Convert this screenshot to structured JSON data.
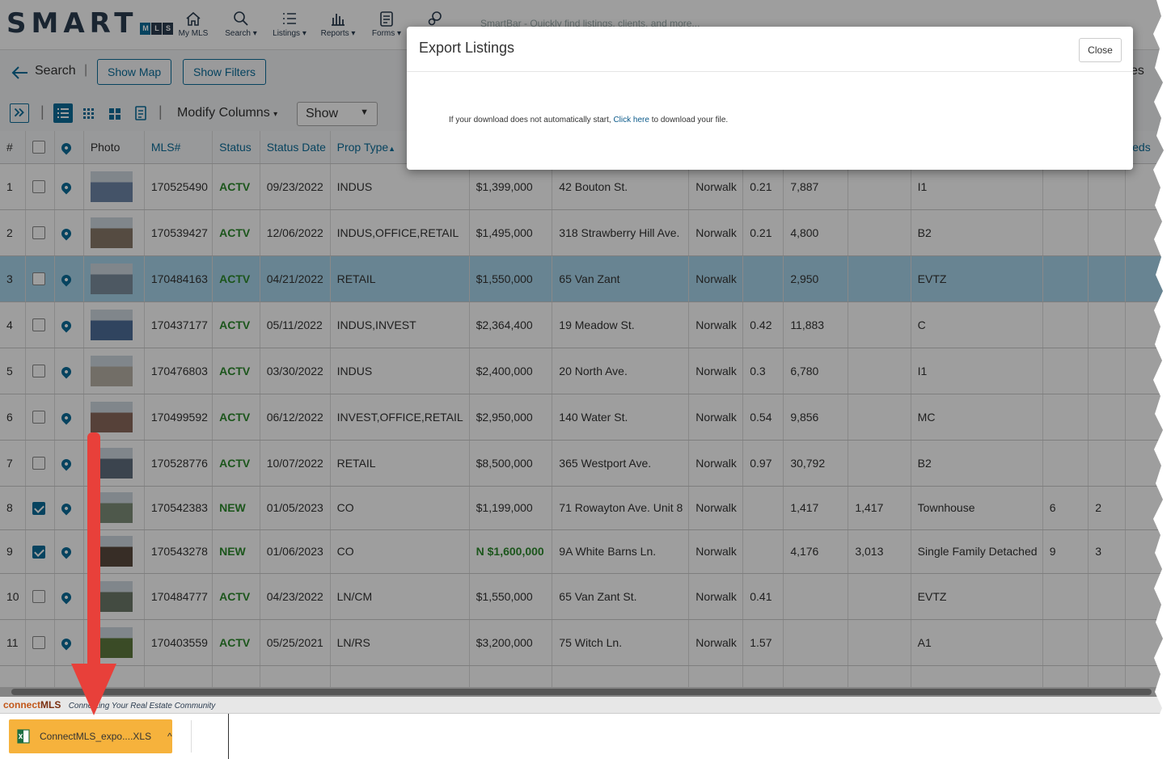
{
  "header": {
    "logo_text": "SMART",
    "logo_mls": [
      "M",
      "L",
      "S"
    ],
    "nav": [
      {
        "label": "My MLS",
        "icon": "home-icon"
      },
      {
        "label": "Search ▾",
        "icon": "search-icon"
      },
      {
        "label": "Listings ▾",
        "icon": "list-icon"
      },
      {
        "label": "Reports ▾",
        "icon": "bar-chart-icon"
      },
      {
        "label": "Forms ▾",
        "icon": "document-icon"
      },
      {
        "label": "",
        "icon": "gears-icon"
      }
    ],
    "smartbar_placeholder": "SmartBar - Quickly find listings, clients, and more..."
  },
  "toolbar": {
    "back_label": "Search",
    "show_map": "Show Map",
    "show_filters": "Show Filters",
    "right_partial": "es",
    "modify_columns": "Modify Columns",
    "show_select": "Show"
  },
  "grid": {
    "columns": [
      "#",
      "",
      "",
      "Photo",
      "MLS#",
      "Status",
      "Status Date",
      "Prop Type",
      "",
      "",
      "",
      "",
      "",
      "",
      "",
      "",
      "",
      "eds"
    ],
    "rows": [
      {
        "num": "1",
        "checked": false,
        "mls": "170525490",
        "status": "ACTV",
        "date": "09/23/2022",
        "type": "INDUS",
        "price": "$1,399,000",
        "address": "42 Bouton St.",
        "town": "Norwalk",
        "acres": "0.21",
        "sqft": "7,887",
        "sqft2": "",
        "zone": "I1",
        "c1": "",
        "c2": "",
        "selected": false,
        "price_hi": false,
        "photo": "#6f86a8"
      },
      {
        "num": "2",
        "checked": false,
        "mls": "170539427",
        "status": "ACTV",
        "date": "12/06/2022",
        "type": "INDUS,OFFICE,RETAIL",
        "price": "$1,495,000",
        "address": "318 Strawberry Hill Ave.",
        "town": "Norwalk",
        "acres": "0.21",
        "sqft": "4,800",
        "sqft2": "",
        "zone": "B2",
        "c1": "",
        "c2": "",
        "selected": false,
        "price_hi": false,
        "photo": "#8a7a6a"
      },
      {
        "num": "3",
        "checked": false,
        "mls": "170484163",
        "status": "ACTV",
        "date": "04/21/2022",
        "type": "RETAIL",
        "price": "$1,550,000",
        "address": "65 Van Zant",
        "town": "Norwalk",
        "acres": "",
        "sqft": "2,950",
        "sqft2": "",
        "zone": "EVTZ",
        "c1": "",
        "c2": "",
        "selected": true,
        "price_hi": false,
        "photo": "#7d8f9f"
      },
      {
        "num": "4",
        "checked": false,
        "mls": "170437177",
        "status": "ACTV",
        "date": "05/11/2022",
        "type": "INDUS,INVEST",
        "price": "$2,364,400",
        "address": "19 Meadow St.",
        "town": "Norwalk",
        "acres": "0.42",
        "sqft": "11,883",
        "sqft2": "",
        "zone": "C",
        "c1": "",
        "c2": "",
        "selected": false,
        "price_hi": false,
        "photo": "#4e6f9a"
      },
      {
        "num": "5",
        "checked": false,
        "mls": "170476803",
        "status": "ACTV",
        "date": "03/30/2022",
        "type": "INDUS",
        "price": "$2,400,000",
        "address": "20 North Ave.",
        "town": "Norwalk",
        "acres": "0.3",
        "sqft": "6,780",
        "sqft2": "",
        "zone": "I1",
        "c1": "",
        "c2": "",
        "selected": false,
        "price_hi": false,
        "photo": "#b9b2a6"
      },
      {
        "num": "6",
        "checked": false,
        "mls": "170499592",
        "status": "ACTV",
        "date": "06/12/2022",
        "type": "INVEST,OFFICE,RETAIL",
        "price": "$2,950,000",
        "address": "140 Water St.",
        "town": "Norwalk",
        "acres": "0.54",
        "sqft": "9,856",
        "sqft2": "",
        "zone": "MC",
        "c1": "",
        "c2": "",
        "selected": false,
        "price_hi": false,
        "photo": "#8b6a5c"
      },
      {
        "num": "7",
        "checked": false,
        "mls": "170528776",
        "status": "ACTV",
        "date": "10/07/2022",
        "type": "RETAIL",
        "price": "$8,500,000",
        "address": "365 Westport Ave.",
        "town": "Norwalk",
        "acres": "0.97",
        "sqft": "30,792",
        "sqft2": "",
        "zone": "B2",
        "c1": "",
        "c2": "",
        "selected": false,
        "price_hi": false,
        "photo": "#5f6f7f"
      },
      {
        "num": "8",
        "checked": true,
        "mls": "170542383",
        "status": "NEW",
        "date": "01/05/2023",
        "type": "CO",
        "price": "$1,199,000",
        "address": "71 Rowayton Ave. Unit 8",
        "town": "Norwalk",
        "acres": "",
        "sqft": "1,417",
        "sqft2": "1,417",
        "zone": "Townhouse",
        "c1": "6",
        "c2": "2",
        "selected": false,
        "price_hi": false,
        "photo": "#7f8f7a"
      },
      {
        "num": "9",
        "checked": true,
        "mls": "170543278",
        "status": "NEW",
        "date": "01/06/2023",
        "type": "CO",
        "price": "N $1,600,000",
        "address": "9A White Barns Ln.",
        "town": "Norwalk",
        "acres": "",
        "sqft": "4,176",
        "sqft2": "3,013",
        "zone": "Single Family Detached",
        "c1": "9",
        "c2": "3",
        "selected": false,
        "price_hi": true,
        "photo": "#5a4a3e"
      },
      {
        "num": "10",
        "checked": false,
        "mls": "170484777",
        "status": "ACTV",
        "date": "04/23/2022",
        "type": "LN/CM",
        "price": "$1,550,000",
        "address": "65 Van Zant St.",
        "town": "Norwalk",
        "acres": "0.41",
        "sqft": "",
        "sqft2": "",
        "zone": "EVTZ",
        "c1": "",
        "c2": "",
        "selected": false,
        "price_hi": false,
        "photo": "#6d7a6a"
      },
      {
        "num": "11",
        "checked": false,
        "mls": "170403559",
        "status": "ACTV",
        "date": "05/25/2021",
        "type": "LN/RS",
        "price": "$3,200,000",
        "address": "75 Witch Ln.",
        "town": "Norwalk",
        "acres": "1.57",
        "sqft": "",
        "sqft2": "",
        "zone": "A1",
        "c1": "",
        "c2": "",
        "selected": false,
        "price_hi": false,
        "photo": "#5e7a3e"
      }
    ]
  },
  "modal": {
    "title": "Export Listings",
    "close": "Close",
    "msg_before": "If your download does not automatically start, ",
    "link": "Click here",
    "msg_after": " to download your file."
  },
  "footer": {
    "brand_a": "connect",
    "brand_b": "MLS",
    "tagline": "Connecting Your Real Estate Community"
  },
  "download": {
    "filename": "ConnectMLS_expo....XLS",
    "icon": "excel-file-icon"
  },
  "colors": {
    "accent": "#0b6d9a",
    "status_green": "#2e8b2e",
    "selected_row": "#a9d6ec",
    "download_bg": "#f6b23c",
    "arrow": "#e8403a"
  }
}
